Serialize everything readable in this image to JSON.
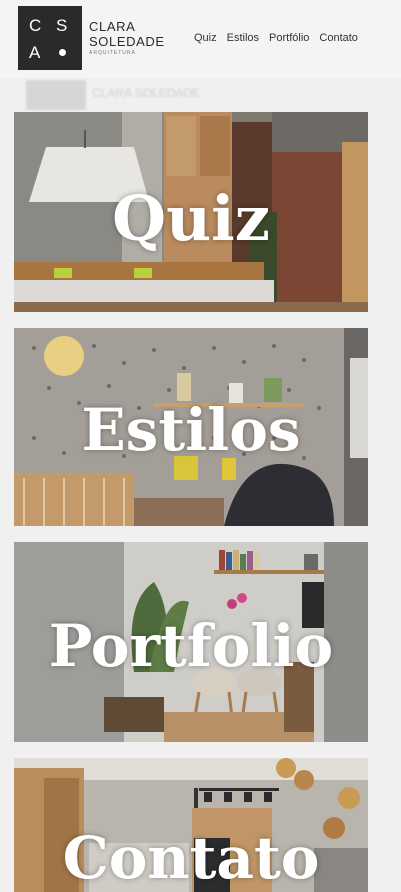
{
  "brand": {
    "logo_letters": [
      "C",
      "S",
      "A"
    ],
    "name_line1": "CLARA",
    "name_line2": "SOLEDADE",
    "tagline": "ARQUITETURA"
  },
  "nav": [
    "Quiz",
    "Estilos",
    "Portfólio",
    "Contato"
  ],
  "ghost": {
    "text": "CLARA SOLEDADE"
  },
  "cards": [
    {
      "label": "Quiz",
      "scene": "kitchen-scene"
    },
    {
      "label": "Estilos",
      "scene": "kids-room-scene"
    },
    {
      "label": "Portfolio",
      "scene": "living-room-scene"
    },
    {
      "label": "Contato",
      "scene": "kitchen-pendant-scene"
    }
  ],
  "colors": {
    "header_bg": "#f4f4f4",
    "logo_bg": "#2a2a2a",
    "label_text": "#ffffff"
  }
}
